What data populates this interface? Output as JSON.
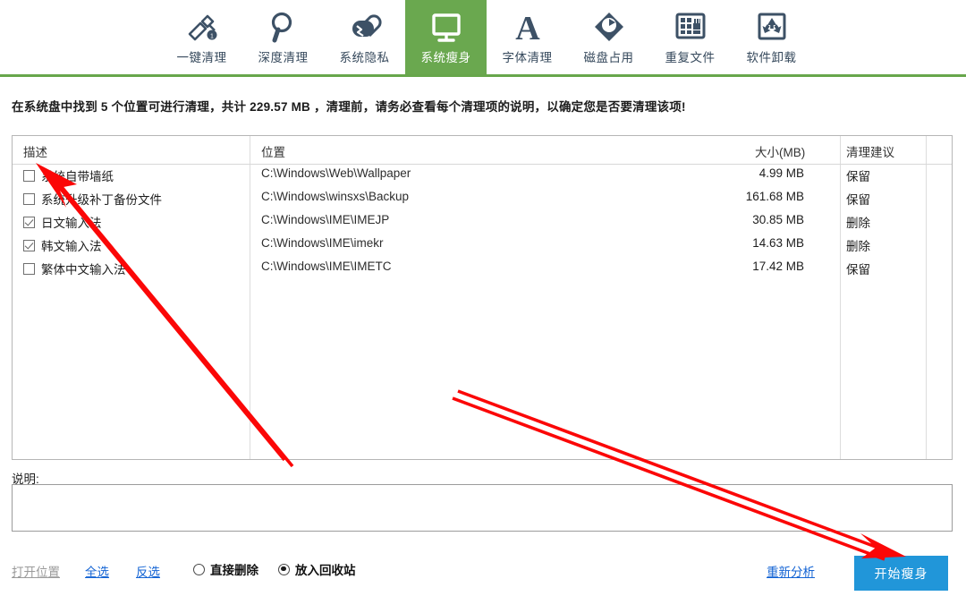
{
  "toolbar": {
    "tabs": [
      {
        "label": "一键清理",
        "icon": "broom-icon",
        "active": false
      },
      {
        "label": "深度清理",
        "icon": "magnifier-icon",
        "active": false
      },
      {
        "label": "系统隐私",
        "icon": "lock-icon",
        "active": false
      },
      {
        "label": "系统瘦身",
        "icon": "monitor-icon",
        "active": true
      },
      {
        "label": "字体清理",
        "icon": "letter-a-icon",
        "active": false
      },
      {
        "label": "磁盘占用",
        "icon": "disk-icon",
        "active": false
      },
      {
        "label": "重复文件",
        "icon": "grid-files-icon",
        "active": false
      },
      {
        "label": "软件卸载",
        "icon": "recycle-icon",
        "active": false
      }
    ],
    "accent_color": "#6aa84f"
  },
  "info": {
    "text": "在系统盘中找到 5 个位置可进行清理，共计 229.57 MB ，清理前，请务必查看每个清理项的说明，以确定您是否要清理该项!",
    "found_count": "5",
    "total_size": "229.57 MB"
  },
  "table": {
    "headers": {
      "description": "描述",
      "location": "位置",
      "size": "大小(MB)",
      "advice": "清理建议"
    },
    "rows": [
      {
        "checked": false,
        "description": "系统自带墙纸",
        "location": "C:\\Windows\\Web\\Wallpaper",
        "size": "4.99 MB",
        "advice": "保留"
      },
      {
        "checked": false,
        "description": "系统升级补丁备份文件",
        "location": "C:\\Windows\\winsxs\\Backup",
        "size": "161.68 MB",
        "advice": "保留"
      },
      {
        "checked": true,
        "description": "日文输入法",
        "location": "C:\\Windows\\IME\\IMEJP",
        "size": "30.85 MB",
        "advice": "删除"
      },
      {
        "checked": true,
        "description": "韩文输入法",
        "location": "C:\\Windows\\IME\\imekr",
        "size": "14.63 MB",
        "advice": "删除"
      },
      {
        "checked": false,
        "description": "繁体中文输入法",
        "location": "C:\\Windows\\IME\\IMETC",
        "size": "17.42 MB",
        "advice": "保留"
      }
    ]
  },
  "description_panel": {
    "label": "说明:",
    "value": ""
  },
  "footer": {
    "open_location": "打开位置",
    "select_all": "全选",
    "invert_select": "反选",
    "radio_delete_directly": "直接删除",
    "radio_recycle_bin": "放入回收站",
    "selected_disposal": "放入回收站",
    "reanalyze": "重新分析",
    "start_button": "开始瘦身",
    "start_button_color": "#2196d9",
    "link_color": "#1464d4"
  },
  "annotations": {
    "color": "#fb0707",
    "arrow_1_target": "first-row-checkbox",
    "arrow_2_target": "start-slimming-button"
  }
}
